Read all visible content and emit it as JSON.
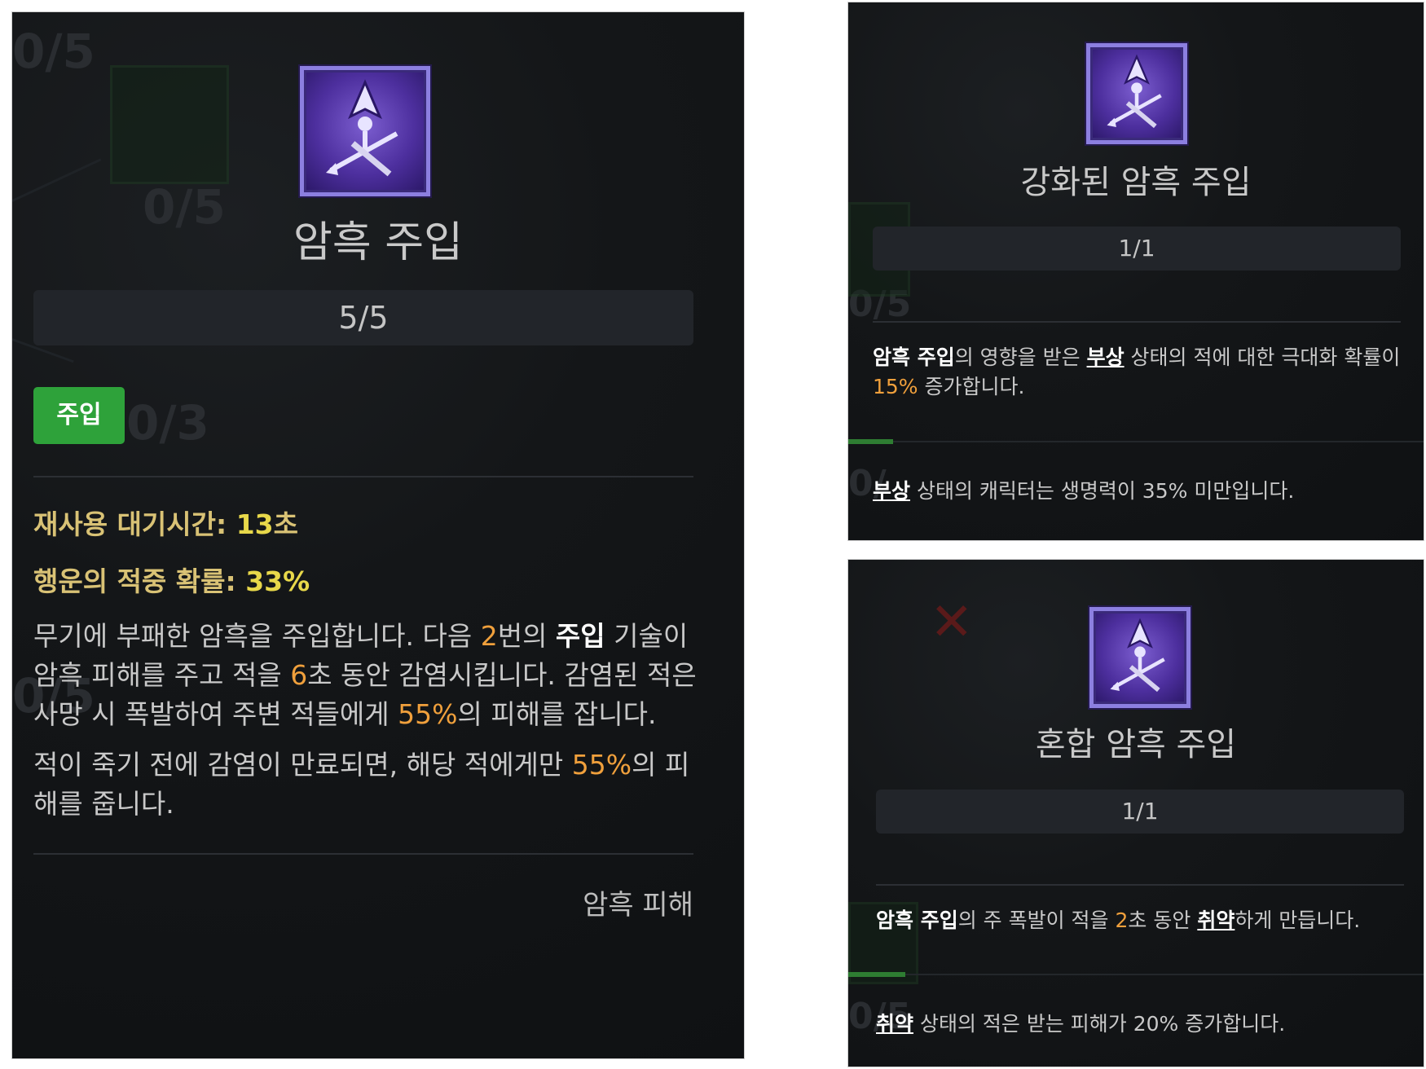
{
  "left": {
    "title": "암흑 주입",
    "rank": "5/5",
    "tag": "주입",
    "cooldown_label": "재사용 대기시간:",
    "cooldown_value": "13",
    "cooldown_unit": "초",
    "lucky_label": "행운의 적중 확률:",
    "lucky_value": "33%",
    "desc1": {
      "p1": "무기에 부패한 암흑을 주입합니다. 다음 ",
      "n1": "2",
      "p2": "번의 ",
      "b1": "주입",
      "p3": " 기술이 암흑 피해를 주고 적을 ",
      "n2": "6",
      "p4": "초 동안 감염시킵니다. 감염된 적은 사망 시 폭발하여 주변 적들에게 ",
      "n3": "55%",
      "p5": "의 피해를 잡니다."
    },
    "desc2": {
      "p1": "적이 죽기 전에 감염이 만료되면, 해당 적에게만 ",
      "n1": "55%",
      "p2": "의 피해를 줍니다."
    },
    "footer": "암흑 피해",
    "ghost_ranks": [
      "0/5",
      "0/5",
      "0/3",
      "0/5"
    ]
  },
  "top_right": {
    "title": "강화된 암흑 주입",
    "rank": "1/1",
    "desc": {
      "b1": "암흑 주입",
      "p1": "의 영향을 받은 ",
      "u1": "부상",
      "p2": " 상태의 적에 대한 극대화 확률이 ",
      "n1": "15%",
      "p3": " 증가합니다."
    },
    "note": {
      "u1": "부상",
      "p1": " 상태의 캐릭터는 생명력이 35% 미만입니다."
    },
    "ghost_ranks": [
      "0/5",
      "0/"
    ]
  },
  "bottom_right": {
    "title": "혼합 암흑 주입",
    "rank": "1/1",
    "desc": {
      "b1": "암흑 주입",
      "p1": "의 주 폭발이 적을 ",
      "n1": "2",
      "p2": "초 동안 ",
      "u1": "취약",
      "p3": "하게 만듭니다."
    },
    "note": {
      "u1": "취약",
      "p1": " 상태의 적은 받는 피해가 20% 증가합니다."
    },
    "ghost_ranks": [
      "0/5"
    ]
  },
  "colors": {
    "accent_green": "#2ea23a",
    "value_orange": "#f0a03c",
    "stat_gold": "#d9c275",
    "icon_purple": "#4d2f9e"
  },
  "icons": [
    "shadow-imbuement-icon"
  ]
}
